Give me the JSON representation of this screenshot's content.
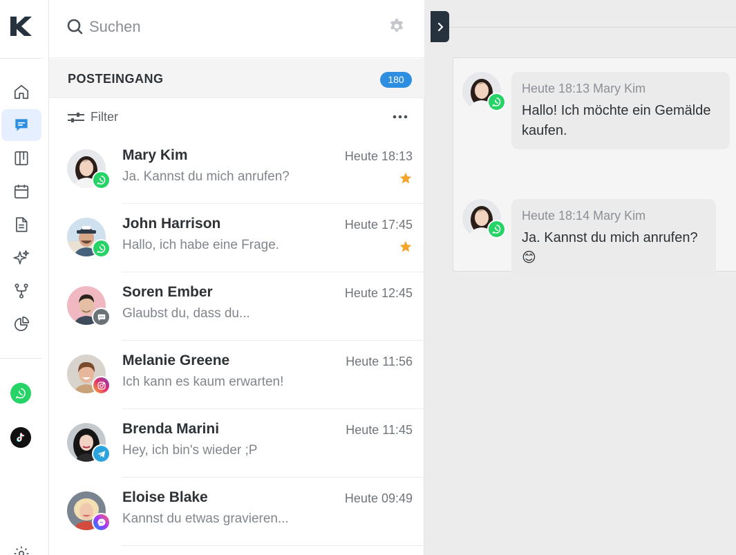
{
  "search": {
    "placeholder": "Suchen"
  },
  "inbox": {
    "title": "POSTEINGANG",
    "count": "180",
    "filter_label": "Filter"
  },
  "rail": {
    "items": [
      "home-icon",
      "chat-icon",
      "kanban-icon",
      "calendar-icon",
      "document-icon",
      "sparkles-icon",
      "workflow-icon",
      "pie-chart-icon"
    ],
    "active": "chat-icon",
    "channels": [
      "whatsapp-icon",
      "tiktok-icon"
    ]
  },
  "conversations": [
    {
      "name": "Mary Kim",
      "preview": "Ja. Kannst du mich anrufen?",
      "time": "Heute 18:13",
      "channel": "whatsapp",
      "starred": true
    },
    {
      "name": "John Harrison",
      "preview": "Hallo, ich habe eine Frage.",
      "time": "Heute 17:45",
      "channel": "whatsapp",
      "starred": true
    },
    {
      "name": "Soren Ember",
      "preview": "Glaubst du, dass du...",
      "time": "Heute 12:45",
      "channel": "chat",
      "starred": false
    },
    {
      "name": "Melanie Greene",
      "preview": "Ich kann es kaum erwarten!",
      "time": "Heute 11:56",
      "channel": "instagram",
      "starred": false
    },
    {
      "name": "Brenda Marini",
      "preview": "Hey, ich bin's wieder ;P",
      "time": "Heute 11:45",
      "channel": "telegram",
      "starred": false
    },
    {
      "name": "Eloise Blake",
      "preview": "Kannst du etwas gravieren...",
      "time": "Heute 09:49",
      "channel": "messenger",
      "starred": false
    }
  ],
  "messages": [
    {
      "meta": "Heute 18:13 Mary Kim",
      "text": "Hallo! Ich möchte ein Gemälde kaufen."
    },
    {
      "meta": "Heute 18:14 Mary Kim",
      "text": "Ja. Kannst du mich anrufen? 😊"
    }
  ],
  "colors": {
    "accent": "#2e8ee0",
    "whatsapp": "#25d366",
    "star": "#f4a62a",
    "dark": "#26333f"
  }
}
